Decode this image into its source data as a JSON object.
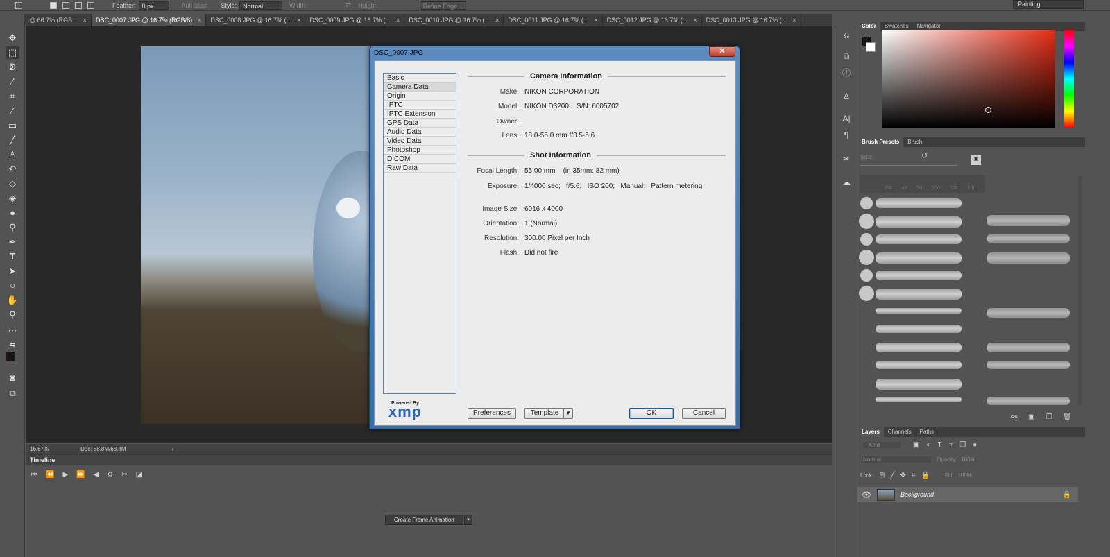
{
  "options_bar": {
    "feather_label": "Feather:",
    "feather_value": "0 px",
    "antialias_label": "Anti-alias",
    "style_label": "Style:",
    "style_value": "Normal",
    "width_label": "Width:",
    "height_label": "Height:",
    "refine_edge_label": "Refine Edge...",
    "workspace_value": "Painting"
  },
  "tabs": [
    {
      "label": "@ 66.7% (RGB...",
      "active": false
    },
    {
      "label": "DSC_0007.JPG @ 16.7% (RGB/8)",
      "active": true
    },
    {
      "label": "DSC_0008.JPG @ 16.7% (...",
      "active": false
    },
    {
      "label": "DSC_0009.JPG @ 16.7% (...",
      "active": false
    },
    {
      "label": "DSC_0010.JPG @ 16.7% (...",
      "active": false
    },
    {
      "label": "DSC_0011.JPG @ 16.7% (...",
      "active": false
    },
    {
      "label": "DSC_0012.JPG @ 16.7% (...",
      "active": false
    },
    {
      "label": "DSC_0013.JPG @ 16.7% (...",
      "active": false
    }
  ],
  "status_bar": {
    "zoom": "16.67%",
    "doc_size": "Doc: 68.8M/68.8M"
  },
  "timeline": {
    "title": "Timeline",
    "create_button": "Create Frame Animation"
  },
  "dialog": {
    "title": "DSC_0007.JPG",
    "close_glyph": "✕",
    "categories": [
      "Basic",
      "Camera Data",
      "Origin",
      "IPTC",
      "IPTC Extension",
      "GPS Data",
      "Audio Data",
      "Video Data",
      "Photoshop",
      "DICOM",
      "Raw Data"
    ],
    "selected_category": "Camera Data",
    "camera_section": "Camera Information",
    "shot_section": "Shot Information",
    "camera_rows": [
      {
        "key": "Make:",
        "value": "NIKON CORPORATION"
      },
      {
        "key": "Model:",
        "value": "NIKON D3200;   S/N: 6005702"
      },
      {
        "key": "Owner:",
        "value": ""
      },
      {
        "key": "Lens:",
        "value": "18.0-55.0 mm f/3.5-5.6"
      }
    ],
    "shot_rows": [
      {
        "key": "Focal Length:",
        "value": "55.00 mm    (in 35mm: 82 mm)"
      },
      {
        "key": "Exposure:",
        "value": "1/4000 sec;   f/5.6;   ISO 200;   Manual;   Pattern metering"
      },
      {
        "key": "Image Size:",
        "value": "6016 x 4000"
      },
      {
        "key": "Orientation:",
        "value": "1 (Normal)"
      },
      {
        "key": "Resolution:",
        "value": "300.00 Pixel per Inch"
      },
      {
        "key": "Flash:",
        "value": "Did not fire"
      }
    ],
    "powered_by": "Powered By",
    "xmp_logo": "xmp",
    "preferences_button": "Preferences",
    "template_button": "Template",
    "ok_button": "OK",
    "cancel_button": "Cancel"
  },
  "color_panel": {
    "tabs": [
      "Color",
      "Swatches",
      "Navigator"
    ],
    "active_tab": "Color",
    "hue_color": "#e52b14"
  },
  "brush_panel": {
    "tabs": [
      "Brush Presets",
      "Brush"
    ],
    "active_tab": "Brush Presets",
    "size_label": "Size:",
    "size_markers": [
      "150",
      "40",
      "50",
      "200",
      "120",
      "100"
    ]
  },
  "layers_panel": {
    "tabs": [
      "Layers",
      "Channels",
      "Paths"
    ],
    "active_tab": "Layers",
    "kind_label": "Kind",
    "blend_mode": "Normal",
    "opacity_label": "Opacity:",
    "opacity_value": "100%",
    "lock_label": "Lock:",
    "fill_label": "Fill:",
    "fill_value": "100%",
    "layer_name": "Background"
  }
}
